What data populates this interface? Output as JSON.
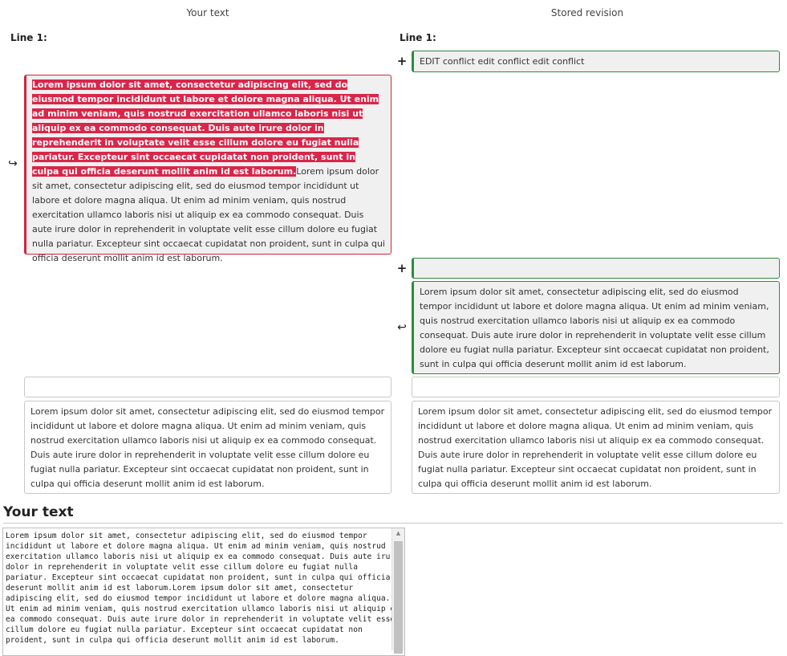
{
  "columns": {
    "left_heading": "Your text",
    "right_heading": "Stored revision"
  },
  "left": {
    "line_label": "Line 1:",
    "removed_highlight": "Lorem ipsum dolor sit amet, consectetur adipiscing elit, sed do eiusmod tempor incididunt ut labore et dolore magna aliqua. Ut enim ad minim veniam, quis nostrud exercitation ullamco laboris nisi ut aliquip ex ea commodo consequat. Duis aute irure dolor in reprehenderit in voluptate velit esse cillum dolore eu fugiat nulla pariatur. Excepteur sint occaecat cupidatat non proident, sunt in culpa qui officia deserunt mollit anim id est laborum.",
    "removed_rest": "Lorem ipsum dolor sit amet, consectetur adipiscing elit, sed do eiusmod tempor incididunt ut labore et dolore magna aliqua. Ut enim ad minim veniam, quis nostrud exercitation ullamco laboris nisi ut aliquip ex ea commodo consequat. Duis aute irure dolor in reprehenderit in voluptate velit esse cillum dolore eu fugiat nulla pariatur. Excepteur sint occaecat cupidatat non proident, sunt in culpa qui officia deserunt mollit anim id est laborum.",
    "empty_line": "",
    "context_paragraph": "Lorem ipsum dolor sit amet, consectetur adipiscing elit, sed do eiusmod tempor incididunt ut labore et dolore magna aliqua. Ut enim ad minim veniam, quis nostrud exercitation ullamco laboris nisi ut aliquip ex ea commodo consequat. Duis aute irure dolor in reprehenderit in voluptate velit esse cillum dolore eu fugiat nulla pariatur. Excepteur sint occaecat cupidatat non proident, sunt in culpa qui officia deserunt mollit anim id est laborum."
  },
  "right": {
    "line_label": "Line 1:",
    "added_line": "EDIT conflict edit conflict edit conflict",
    "added_empty": "",
    "added_paragraph": "Lorem ipsum dolor sit amet, consectetur adipiscing elit, sed do eiusmod tempor incididunt ut labore et dolore magna aliqua. Ut enim ad minim veniam, quis nostrud exercitation ullamco laboris nisi ut aliquip ex ea commodo consequat. Duis aute irure dolor in reprehenderit in voluptate velit esse cillum dolore eu fugiat nulla pariatur. Excepteur sint occaecat cupidatat non proident, sunt in culpa qui officia deserunt mollit anim id est laborum.",
    "empty_line": "",
    "context_paragraph": "Lorem ipsum dolor sit amet, consectetur adipiscing elit, sed do eiusmod tempor incididunt ut labore et dolore magna aliqua. Ut enim ad minim veniam, quis nostrud exercitation ullamco laboris nisi ut aliquip ex ea commodo consequat. Duis aute irure dolor in reprehenderit in voluptate velit esse cillum dolore eu fugiat nulla pariatur. Excepteur sint occaecat cupidatat non proident, sunt in culpa qui officia deserunt mollit anim id est laborum."
  },
  "markers": {
    "plus": "+",
    "move_left": "↪",
    "move_right": "↩"
  },
  "editor": {
    "title": "Your text",
    "content": "Lorem ipsum dolor sit amet, consectetur adipiscing elit, sed do eiusmod tempor incididunt ut labore et dolore magna aliqua. Ut enim ad minim veniam, quis nostrud exercitation ullamco laboris nisi ut aliquip ex ea commodo consequat. Duis aute irure dolor in reprehenderit in voluptate velit esse cillum dolore eu fugiat nulla pariatur. Excepteur sint occaecat cupidatat non proident, sunt in culpa qui officia deserunt mollit anim id est laborum.Lorem ipsum dolor sit amet, consectetur adipiscing elit, sed do eiusmod tempor incididunt ut labore et dolore magna aliqua. Ut enim ad minim veniam, quis nostrud exercitation ullamco laboris nisi ut aliquip ex ea commodo consequat. Duis aute irure dolor in reprehenderit in voluptate velit esse cillum dolore eu fugiat nulla pariatur. Excepteur sint occaecat cupidatat non proident, sunt in culpa qui officia deserunt mollit anim id est laborum."
  },
  "colors": {
    "removed": "#d9264a",
    "added": "#2e8b3c",
    "box_grey": "#f0f0f0"
  }
}
